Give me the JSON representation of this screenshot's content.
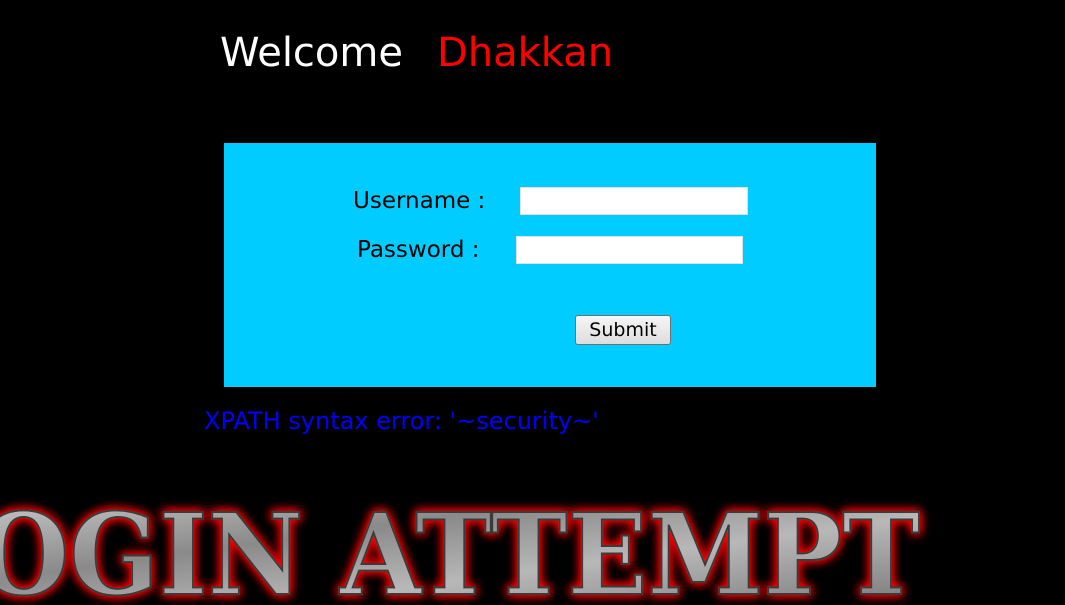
{
  "header": {
    "greeting": "Welcome",
    "username": "Dhakkan"
  },
  "login_form": {
    "username_label": "Username :",
    "password_label": "Password :",
    "username_value": "",
    "password_value": "",
    "submit_label": "Submit"
  },
  "error": {
    "message": "XPATH syntax error: '~security~'"
  },
  "banner": {
    "text": "OGIN ATTEMPT"
  },
  "colors": {
    "background": "#000000",
    "form_background": "#00ccff",
    "welcome_name": "#ff0000",
    "error_text": "#0000ff",
    "banner_glow": "#ff0000"
  }
}
